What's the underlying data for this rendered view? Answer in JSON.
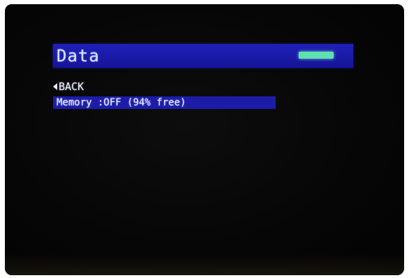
{
  "screen": {
    "title": "Data",
    "back_label": "BACK",
    "menu_items": [
      {
        "label": "Memory :OFF (94% free)",
        "selected": true
      }
    ]
  },
  "colors": {
    "background": "#050505",
    "title_bar": "#1a1aa6",
    "selection": "#1c1ca8",
    "text": "#e8eeff",
    "battery": "#5fe0b0"
  },
  "icons": {
    "back": "left-triangle-icon",
    "battery": "battery-icon"
  }
}
